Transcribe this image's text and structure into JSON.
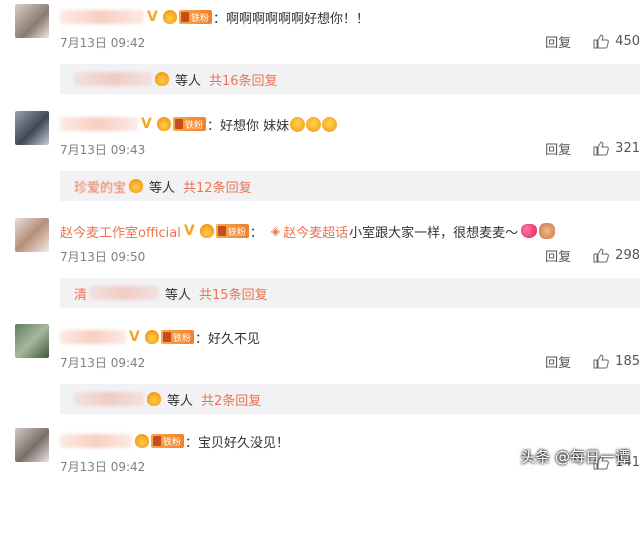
{
  "comments": [
    {
      "text": "：啊啊啊啊啊啊好想你！！",
      "date": "7月13日 09:42",
      "reply_label": "回复",
      "likes": "450",
      "sub": {
        "suffix": "等人",
        "total": "共16条回复"
      }
    },
    {
      "text": "：好想你  妹妹",
      "date": "7月13日 09:43",
      "reply_label": "回复",
      "likes": "321",
      "sub": {
        "prefix": "珍爱的宝",
        "suffix": "等人",
        "total": "共12条回复"
      }
    },
    {
      "name": "赵今麦工作室official",
      "topic": "赵今麦超话",
      "text": "小室跟大家一样，很想麦麦～",
      "date": "7月13日 09:50",
      "reply_label": "回复",
      "likes": "298",
      "sub": {
        "prefix": "清",
        "suffix": "等人",
        "total": "共15条回复"
      }
    },
    {
      "text": "：好久不见",
      "date": "7月13日 09:42",
      "reply_label": "回复",
      "likes": "185",
      "sub": {
        "suffix": "等人",
        "total": "共2条回复"
      }
    },
    {
      "text": "：宝贝好久没见！",
      "date": "7月13日 09:42",
      "reply_label": "回复",
      "likes": "141"
    }
  ],
  "badges": {
    "fan_label": "铁粉",
    "verified": "V"
  },
  "watermark": "头条 @每日一谭",
  "colors": {
    "accent": "#eb7350",
    "sub_bg": "#f2f2f5",
    "meta": "#808080"
  }
}
